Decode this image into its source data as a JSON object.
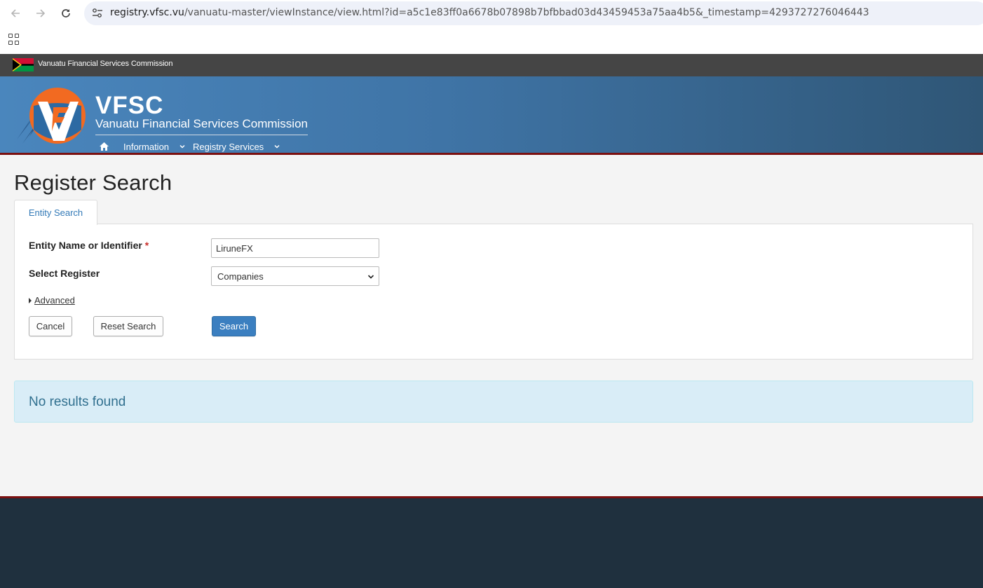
{
  "browser": {
    "url_host": "registry.vfsc.vu",
    "url_rest": "/vanuatu-master/viewInstance/view.html?id=a5c1e83ff0a6678b07898b7bfbbad03d43459453a75aa4b5&_timestamp=4293727276046443"
  },
  "top_strip": {
    "text": "Vanuatu Financial Services Commission"
  },
  "header": {
    "brand_title": "VFSC",
    "brand_subtitle": "Vanuatu Financial Services Commission",
    "nav": {
      "information": "Information",
      "registry_services": "Registry Services"
    }
  },
  "main": {
    "title": "Register Search",
    "tab_label": "Entity Search",
    "form": {
      "entity_label": "Entity Name or Identifier",
      "required_mark": "*",
      "entity_value": "LiruneFX",
      "register_label": "Select Register",
      "register_value": "Companies",
      "advanced_label": "Advanced"
    },
    "buttons": {
      "cancel": "Cancel",
      "reset": "Reset Search",
      "search": "Search"
    },
    "alert": "No results found"
  },
  "colors": {
    "header_blue": "#4a86bd",
    "accent_red": "#7a1010",
    "footer": "#1f303e",
    "logo_orange": "#f26a21"
  }
}
